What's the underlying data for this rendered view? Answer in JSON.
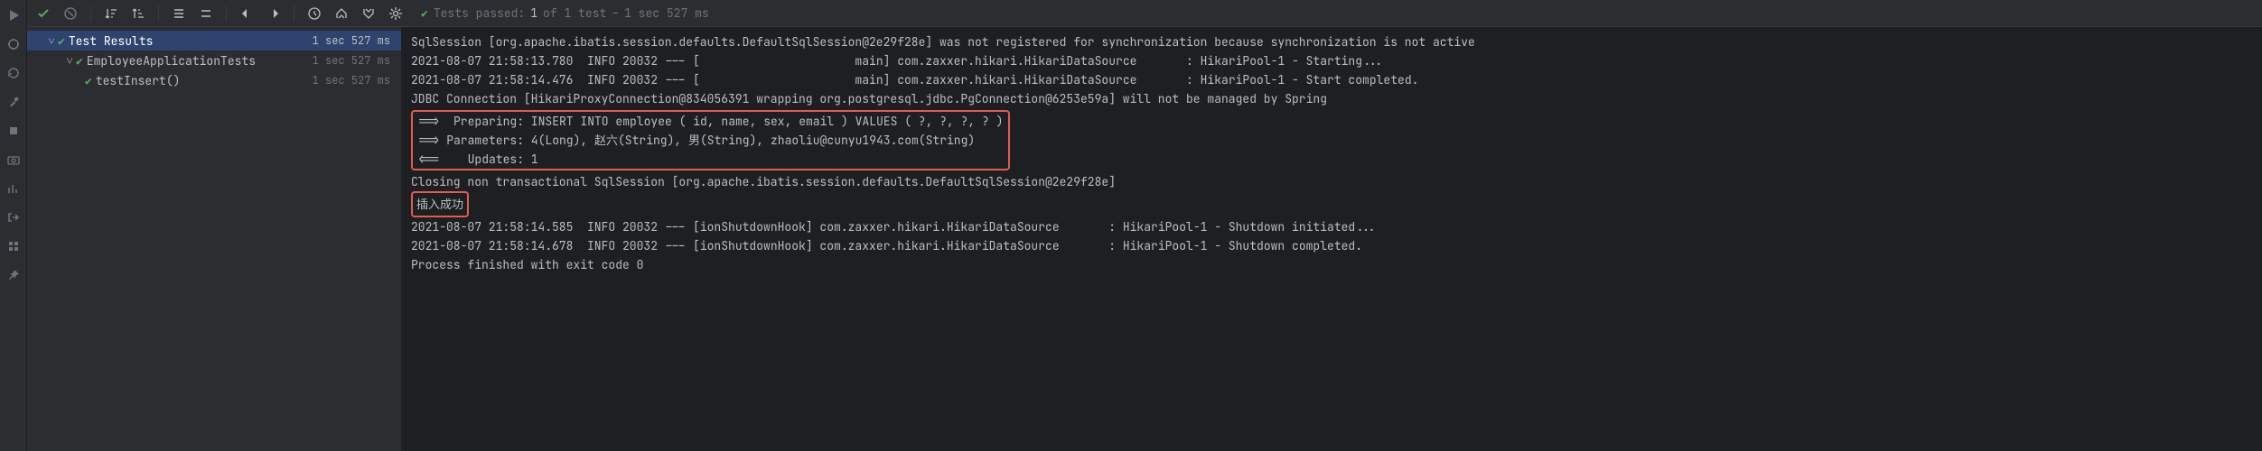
{
  "toolbar_status": {
    "label": "Tests passed:",
    "count": "1",
    "of_text": "of 1 test",
    "dash": "–",
    "time": "1 sec 527 ms"
  },
  "tree": {
    "root": {
      "label": "Test Results",
      "time": "1 sec 527 ms"
    },
    "class": {
      "label": "EmployeeApplicationTests",
      "time": "1 sec 527 ms"
    },
    "method": {
      "label": "testInsert()",
      "time": "1 sec 527 ms"
    }
  },
  "console": {
    "l1": "SqlSession [org.apache.ibatis.session.defaults.DefaultSqlSession@2e29f28e] was not registered for synchronization because synchronization is not active",
    "l2a": "2021-08-07 21:58:13.780  INFO 20032 --- [",
    "l2b": "           main] com.zaxxer.hikari.HikariDataSource       : HikariPool-1 - Starting...",
    "l3a": "2021-08-07 21:58:14.476  INFO 20032 --- [",
    "l3b": "           main] com.zaxxer.hikari.HikariDataSource       : HikariPool-1 - Start completed.",
    "l4": "JDBC Connection [HikariProxyConnection@834056391 wrapping org.postgresql.jdbc.PgConnection@6253e59a] will not be managed by Spring",
    "l5": "==>  Preparing: INSERT INTO employee ( id, name, sex, email ) VALUES ( ?, ?, ?, ? )",
    "l6": "==> Parameters: 4(Long), 赵六(String), 男(String), zhaoliu@cunyu1943.com(String)",
    "l7": "<==    Updates: 1",
    "l8": "Closing non transactional SqlSession [org.apache.ibatis.session.defaults.DefaultSqlSession@2e29f28e]",
    "l9": "插入成功",
    "l10a": "2021-08-07 21:58:14.585  INFO 20032 --- [",
    "l10b": "ionShutdownHook] com.zaxxer.hikari.HikariDataSource       : HikariPool-1 - Shutdown initiated...",
    "l11a": "2021-08-07 21:58:14.678  INFO 20032 --- [",
    "l11b": "ionShutdownHook] com.zaxxer.hikari.HikariDataSource       : HikariPool-1 - Shutdown completed.",
    "l12": "",
    "l13": "Process finished with exit code 0"
  }
}
